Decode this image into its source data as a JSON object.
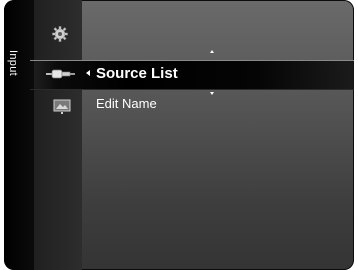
{
  "sidebar": {
    "label": "Input"
  },
  "icons": [
    "gear-icon",
    "input-connector-icon",
    "picture-icon"
  ],
  "menu": {
    "items": [
      {
        "label": "Source List",
        "selected": true
      },
      {
        "label": "Edit Name",
        "selected": false
      }
    ]
  },
  "colors": {
    "panel": "#555555",
    "selected_bg": "#000000",
    "text": "#ffffff"
  }
}
